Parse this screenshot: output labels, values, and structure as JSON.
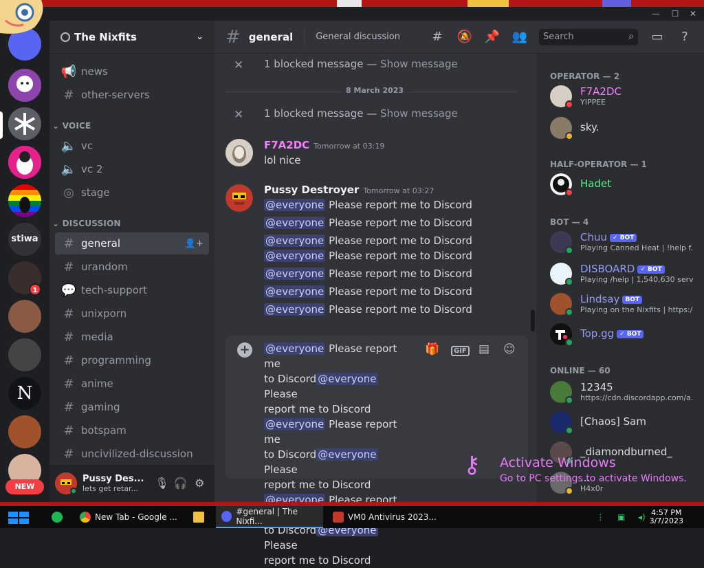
{
  "server": {
    "name": "The Nixfits"
  },
  "guild_rail": {
    "guild_label": "stiwa",
    "mention_count": "1",
    "new_badge": "NEW"
  },
  "categories": {
    "voice": "VOICE",
    "discussion": "DISCUSSION"
  },
  "channels": [
    {
      "label": "news",
      "icon": "announcement-icon"
    },
    {
      "label": "other-servers",
      "icon": "hash-icon"
    },
    {
      "label": "vc",
      "icon": "speaker-icon"
    },
    {
      "label": "vc 2",
      "icon": "speaker-icon"
    },
    {
      "label": "stage",
      "icon": "stage-icon"
    },
    {
      "label": "general",
      "icon": "hash-icon",
      "active": true
    },
    {
      "label": "urandom",
      "icon": "hash-icon"
    },
    {
      "label": "tech-support",
      "icon": "forum-icon"
    },
    {
      "label": "unixporn",
      "icon": "hash-icon"
    },
    {
      "label": "media",
      "icon": "hash-icon"
    },
    {
      "label": "programming",
      "icon": "hash-icon"
    },
    {
      "label": "anime",
      "icon": "hash-icon"
    },
    {
      "label": "gaming",
      "icon": "hash-icon"
    },
    {
      "label": "botspam",
      "icon": "hash-icon"
    },
    {
      "label": "uncivilized-discussion",
      "icon": "hash-icon"
    }
  ],
  "user_panel": {
    "name": "Pussy Des...",
    "status": "lets get retar..."
  },
  "header": {
    "channel": "general",
    "topic": "General discussion",
    "search_placeholder": "Search"
  },
  "messages": {
    "blocked_text": "1 blocked message — ",
    "show_message": "Show message",
    "date_divider": "8 March 2023",
    "msg1": {
      "author": "F7A2DC",
      "timestamp": "Tomorrow at 03:19",
      "text": "lol nice",
      "color": "#f47fff"
    },
    "msg2": {
      "author": "Pussy Destroyer",
      "timestamp": "Tomorrow at 03:27",
      "mention": "@everyone",
      "text": " Please report me to Discord",
      "color": "#f2f3f5"
    }
  },
  "composer": {
    "lines": [
      {
        "m": "@everyone",
        "t": " Please report me"
      },
      {
        "t": "to Discord",
        "m": "@everyone",
        "t2": " Please"
      },
      {
        "t": "report me to Discord"
      },
      {
        "m": "@everyone",
        "t": " Please report me"
      },
      {
        "t": "to Discord",
        "m": "@everyone",
        "t2": " Please"
      },
      {
        "t": "report me to Discord"
      },
      {
        "m": "@everyone",
        "t": " Please report me"
      },
      {
        "t": "to Discord",
        "m": "@everyone",
        "t2": " Please"
      },
      {
        "t": "report me to Discord"
      }
    ],
    "gif_label": "GIF"
  },
  "members": {
    "operator_heading": "OPERATOR — 2",
    "halfop_heading": "HALF-OPERATOR — 1",
    "bot_heading": "BOT — 4",
    "online_heading": "ONLINE — 60",
    "bot_label": "BOT",
    "list": [
      {
        "name": "F7A2DC",
        "status": "YIPPEE",
        "color": "#f47fff"
      },
      {
        "name": "sky.",
        "status": "",
        "color": "#dbdee1"
      },
      {
        "name": "Hadet",
        "status": "",
        "color": "#57f287"
      },
      {
        "name": "Chuu",
        "status": "Playing Canned Heat | !help f...",
        "color": "#949cf7",
        "bot": true
      },
      {
        "name": "DISBOARD",
        "status": "Playing /help | 1,540,630 serv...",
        "color": "#949cf7",
        "bot": true
      },
      {
        "name": "Lindsay",
        "status": "Playing on the Nixfits | https:/...",
        "color": "#949cf7",
        "bot": true
      },
      {
        "name": "Top.gg",
        "status": "",
        "color": "#949cf7",
        "bot": true
      },
      {
        "name": "12345",
        "status": "https://cdn.discordapp.com/a...",
        "color": "#dbdee1"
      },
      {
        "name": "[Chaos] Sam",
        "status": "",
        "color": "#dbdee1"
      },
      {
        "name": "_diamondburned_",
        "status": "",
        "color": "#dbdee1"
      },
      {
        "name": "...",
        "status": "H4x0r",
        "color": "#dbdee1"
      }
    ]
  },
  "watermark": {
    "line1": "Activate Windows",
    "line2": "Go to PC settings to activate Windows."
  },
  "taskbar": {
    "items": [
      "New Tab - Google ...",
      "#general | The Nixfi...",
      "VM0 Antivirus 2023..."
    ],
    "time": "4:57 PM",
    "date": "3/7/2023"
  }
}
